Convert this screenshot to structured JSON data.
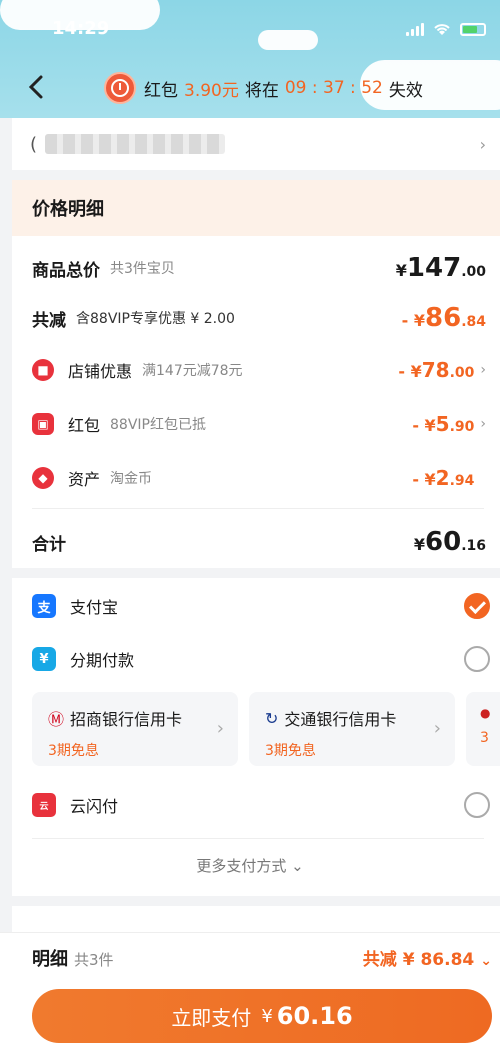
{
  "status_bar": {
    "time": "14:29"
  },
  "header": {
    "red_packet_prefix": "红包",
    "red_packet_amount": "3.90元",
    "expire_mid": "将在",
    "expire_time": "09 : 37 : 52",
    "expire_suffix": "失效"
  },
  "address": {
    "redacted": true
  },
  "price_details": {
    "title": "价格明细",
    "total": {
      "label": "商品总价",
      "sub": "共3件宝贝",
      "yen": "¥",
      "int": "147",
      "dec": ".00"
    },
    "reduce": {
      "label": "共减",
      "sub": "含88VIP专享优惠 ¥ 2.00",
      "yen": "- ¥",
      "int": "86",
      "dec": ".84"
    },
    "items": [
      {
        "label": "店铺优惠",
        "sub": "满147元减78元",
        "yen": "- ¥",
        "int": "78",
        "dec": ".00",
        "icon": "store-icon",
        "color": "#e8323c"
      },
      {
        "label": "红包",
        "sub": "88VIP红包已抵",
        "yen": "- ¥",
        "int": "5",
        "dec": ".90",
        "icon": "red-packet-icon",
        "color": "#e8323c"
      },
      {
        "label": "资产",
        "sub": "淘金币",
        "yen": "- ¥",
        "int": "2",
        "dec": ".94",
        "icon": "coin-icon",
        "color": "#e8323c"
      }
    ],
    "sum": {
      "label": "合计",
      "yen": "¥",
      "int": "60",
      "dec": ".16"
    }
  },
  "payment": {
    "alipay": "支付宝",
    "installment": "分期付款",
    "banks": [
      {
        "name": "招商银行信用卡",
        "plan": "3期免息"
      },
      {
        "name": "交通银行信用卡",
        "plan": "3期免息"
      },
      {
        "name": "",
        "plan": "3"
      }
    ],
    "unionpay": "云闪付",
    "more": "更多支付方式 ⌄"
  },
  "footer": {
    "detail_label": "明细",
    "detail_count": "共3件",
    "reduce_label": "共减",
    "reduce_amount": "¥ 86.84",
    "pay_label": "立即支付",
    "pay_yen": "¥",
    "pay_amount": "60.16"
  },
  "colors": {
    "accent": "#f26522",
    "header_sky": "#8cd6e6"
  }
}
